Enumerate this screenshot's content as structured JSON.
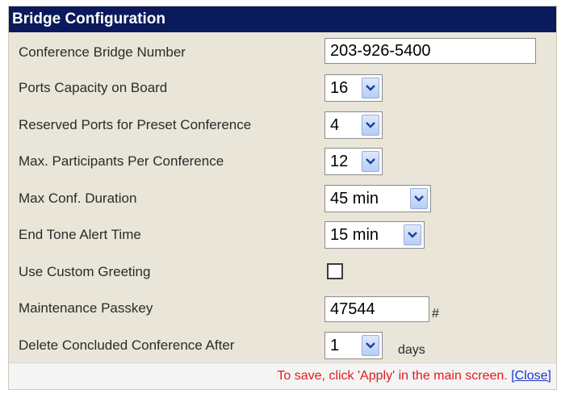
{
  "panel": {
    "title": "Bridge Configuration"
  },
  "fields": {
    "bridge_number": {
      "label": "Conference Bridge Number",
      "value": "203-926-5400"
    },
    "ports_capacity": {
      "label": "Ports Capacity on Board",
      "value": "16"
    },
    "reserved_ports": {
      "label": "Reserved Ports for Preset Conference",
      "value": "4"
    },
    "max_participants": {
      "label": "Max. Participants Per Conference",
      "value": "12"
    },
    "max_duration": {
      "label": "Max Conf. Duration",
      "value": "45 min"
    },
    "end_tone": {
      "label": "End Tone Alert Time",
      "value": "15 min"
    },
    "custom_greeting": {
      "label": "Use Custom Greeting",
      "checked": false
    },
    "maintenance_passkey": {
      "label": "Maintenance Passkey",
      "value": "47544",
      "suffix": "#"
    },
    "delete_after": {
      "label": "Delete Concluded Conference After",
      "value": "1",
      "suffix": "days"
    }
  },
  "footer": {
    "message": "To save, click 'Apply' in the main screen.",
    "close_link": "[Close]"
  },
  "icons": {
    "dropdown": "chevron-down-icon"
  },
  "colors": {
    "title_bg": "#0b1a5c",
    "panel_bg": "#e9e5d8",
    "message": "#e21b1b",
    "link": "#1b35cc"
  }
}
